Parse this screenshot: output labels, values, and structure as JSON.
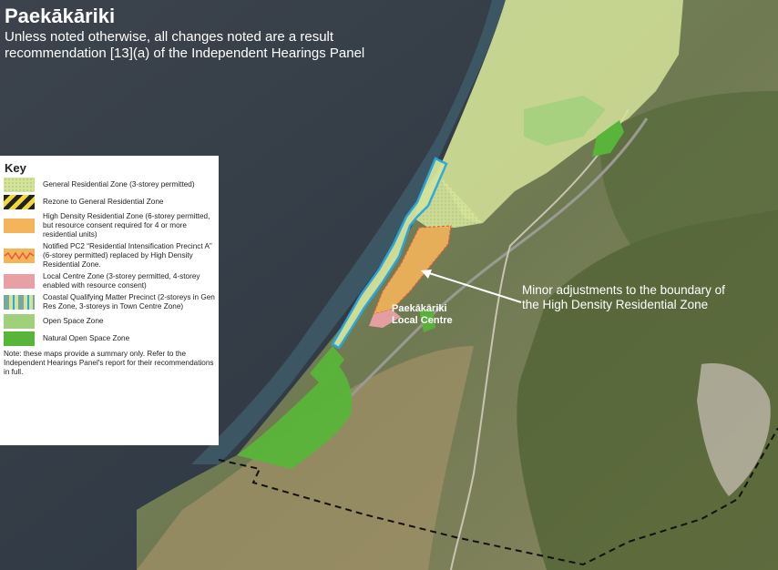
{
  "header": {
    "title": "Paekākāriki",
    "subtitle": "Unless noted otherwise, all changes noted are a result recommendation [13](a) of the Independent Hearings Panel"
  },
  "key": {
    "title": "Key",
    "items": [
      {
        "label": "General Residential Zone (3-storey permitted)",
        "swatch": "general-residential"
      },
      {
        "label": "Rezone to General Residential Zone",
        "swatch": "rezone-hatch"
      },
      {
        "label": "High Density Residential Zone (6-storey permitted, but resource consent required for 4 or more residential units)",
        "swatch": "high-density"
      },
      {
        "label": "Notified PC2 “Residential Intensification Precinct A” (6-storey permitted) replaced by High Density Residential Zone.",
        "swatch": "notified-pc2"
      },
      {
        "label": "Local Centre Zone (3-storey permitted, 4-storey enabled with resource consent)",
        "swatch": "local-centre"
      },
      {
        "label": "Coastal Qualifying Matter Precinct (2-storeys in Gen Res Zone, 3-storeys in Town Centre Zone)",
        "swatch": "coastal-precinct"
      },
      {
        "label": "Open Space Zone",
        "swatch": "open-space"
      },
      {
        "label": "Natural Open Space Zone",
        "swatch": "natural-open-space"
      }
    ],
    "note": "Note: these maps provide a summary only. Refer to the Independent Hearings Panel's report for their recommendations in full."
  },
  "annotation": "Minor adjustments to the boundary of the High Density Residential Zone",
  "place_label": {
    "line1": "Paekākāriki",
    "line2": "Local Centre"
  },
  "colors": {
    "sea": "#2f3a45",
    "general_residential": "#d4e39a",
    "high_density": "#f4b45a",
    "local_centre": "#e9a0a4",
    "coastal_outline": "#29a9e1",
    "open_space": "#9fd07a",
    "natural_open_space": "#58b53a",
    "boundary": "#111111"
  }
}
